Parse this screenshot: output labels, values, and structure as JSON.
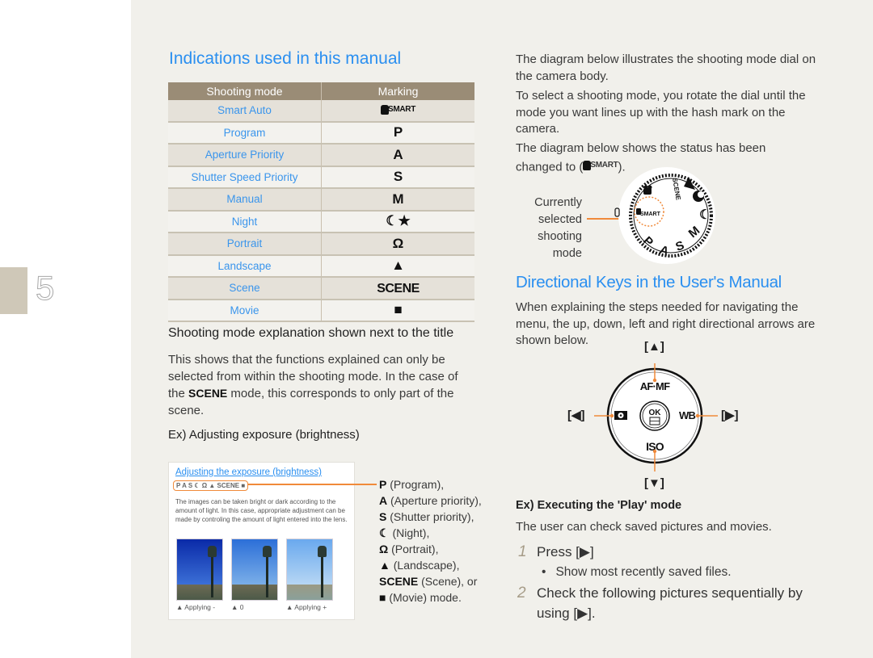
{
  "chapter": {
    "number": "5"
  },
  "left": {
    "title": "Indications used in this manual",
    "table": {
      "headers": [
        "Shooting mode",
        "Marking"
      ],
      "rows": [
        {
          "mode": "Smart Auto",
          "marking": "SMART",
          "icon": "smart-auto-icon"
        },
        {
          "mode": "Program",
          "marking": "P",
          "icon": "program-icon"
        },
        {
          "mode": "Aperture Priority",
          "marking": "A",
          "icon": "aperture-icon"
        },
        {
          "mode": "Shutter Speed Priority",
          "marking": "S",
          "icon": "shutter-icon"
        },
        {
          "mode": "Manual",
          "marking": "M",
          "icon": "manual-icon"
        },
        {
          "mode": "Night",
          "marking": "☾★",
          "icon": "night-icon"
        },
        {
          "mode": "Portrait",
          "marking": "Ω",
          "icon": "portrait-icon"
        },
        {
          "mode": "Landscape",
          "marking": "▲",
          "icon": "landscape-icon"
        },
        {
          "mode": "Scene",
          "marking": "SCENE",
          "icon": "scene-icon"
        },
        {
          "mode": "Movie",
          "marking": "■",
          "icon": "movie-icon"
        }
      ]
    },
    "explanation_heading": "Shooting mode explanation shown next to the title",
    "explanation_text_1": "This shows that the functions explained can only be selected from  within the shooting mode. In the case of the ",
    "explanation_scene": "SCENE",
    "explanation_text_2": " mode, this corresponds to only part of the scene.",
    "example_heading": "Ex) Adjusting exposure (brightness)",
    "example_box": {
      "title": "Adjusting the exposure (brightness)",
      "icons": "P A S ☾ Ω ▲ SCENE ■",
      "text": "The images can be taken bright or dark according to the amount of light.  In this case, appropriate adjustment can be made by controling the amount of light entered into the lens.",
      "captions": [
        "▲ Applying -",
        "▲ 0",
        "▲ Applying +"
      ]
    },
    "mode_list": [
      {
        "sym": "P",
        "label": " (Program),"
      },
      {
        "sym": "A",
        "label": " (Aperture priority),"
      },
      {
        "sym": "S",
        "label": " (Shutter priority),"
      },
      {
        "sym": "☾",
        "label": " (Night),"
      },
      {
        "sym": "Ω",
        "label": " (Portrait),"
      },
      {
        "sym": "▲",
        "label": " (Landscape),"
      },
      {
        "sym": "SCENE",
        "label": " (Scene), or"
      },
      {
        "sym": "■",
        "label": " (Movie) mode."
      }
    ]
  },
  "right": {
    "dial_intro": "The diagram below illustrates the shooting mode dial on the camera body.",
    "dial_instruction": "To select a shooting mode, you rotate the dial until the mode you want lines up with the hash mark on the camera.",
    "dial_status": "The diagram below shows the status has been changed to (",
    "dial_status_end": ").",
    "dial_status_mark": "SMART",
    "callout": "Currently selected shooting mode",
    "dial_labels": [
      "SCENE",
      "SMART",
      "P",
      "A",
      "S",
      "M"
    ],
    "keys_title": "Directional Keys in the User's Manual",
    "keys_text": "When explaining the steps needed for navigating the menu, the up, down, left and right directional arrows are shown below.",
    "keys": {
      "up": "[▲]",
      "down": "[▼]",
      "left": "[◀]",
      "right": "[▶]"
    },
    "dpad_labels": {
      "top": "AF·MF",
      "bottom": "ISO",
      "right": "WB",
      "center": "OK"
    },
    "play_heading": "Ex) Executing the 'Play' mode",
    "play_text": "The user can check saved pictures and movies.",
    "steps": [
      {
        "num": "1",
        "text": "Press [▶]"
      },
      {
        "num": "2",
        "text": "Check the following pictures sequentially by using [▶]."
      }
    ],
    "bullet": "Show most recently saved files."
  }
}
